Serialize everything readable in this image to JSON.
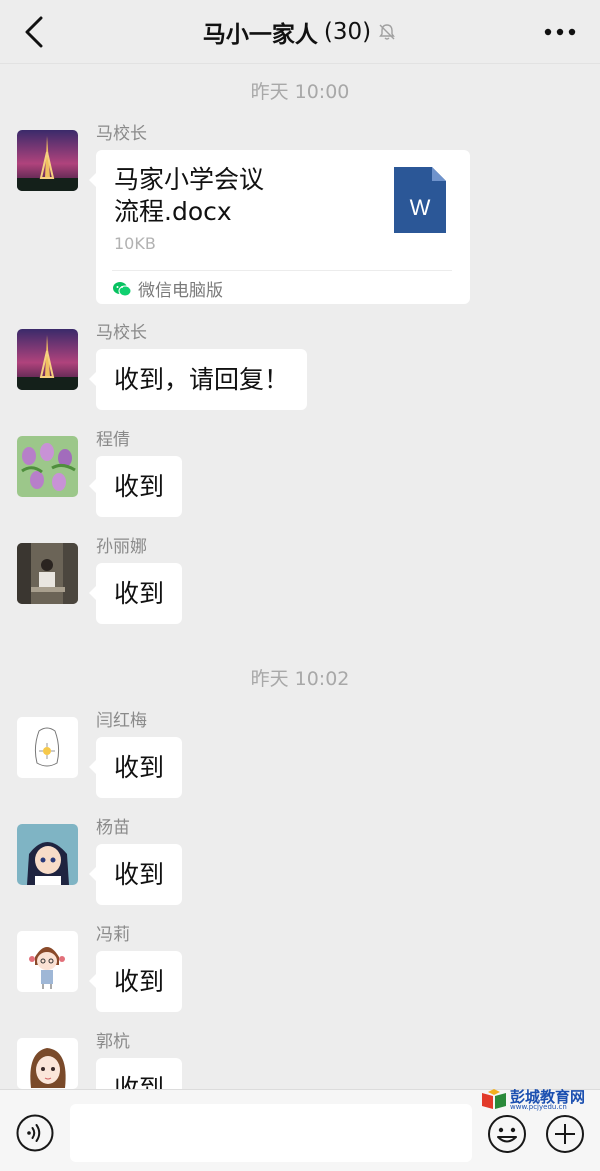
{
  "header": {
    "title": "马小一家人",
    "member_count": "(30)"
  },
  "timestamps": [
    "昨天 10:00",
    "昨天 10:02"
  ],
  "messages": [
    {
      "sender": "马校长",
      "type": "file",
      "file": {
        "name": "马家小学会议流程.docx",
        "name_line1": "马家小学会议",
        "name_line2": "流程.docx",
        "size": "10KB",
        "source": "微信电脑版",
        "icon_letter": "W"
      }
    },
    {
      "sender": "马校长",
      "text": "收到，请回复！"
    },
    {
      "sender": "程倩",
      "text": "收到"
    },
    {
      "sender": "孙丽娜",
      "text": "收到"
    },
    {
      "sender": "闫红梅",
      "text": "收到"
    },
    {
      "sender": "杨苗",
      "text": "收到"
    },
    {
      "sender": "冯莉",
      "text": "收到"
    },
    {
      "sender": "郭杭",
      "text": "收到"
    }
  ],
  "watermark": {
    "text": "彭城教育网",
    "url": "www.pcjyedu.cn"
  },
  "colors": {
    "background": "#ededed",
    "bubble": "#ffffff",
    "word_icon": "#2b5797",
    "accent_green": "#07c160"
  }
}
